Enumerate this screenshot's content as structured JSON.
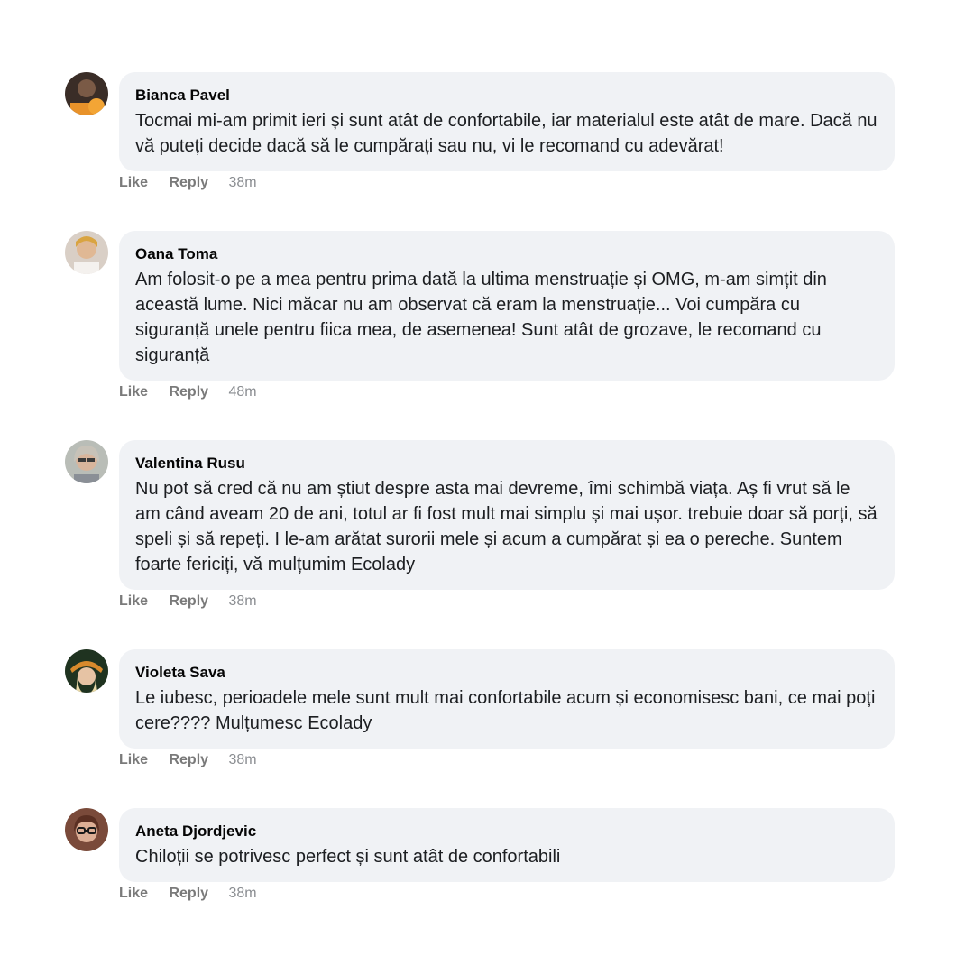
{
  "actions": {
    "like_label": "Like",
    "reply_label": "Reply"
  },
  "colors": {
    "bubble_background": "#f0f2f5",
    "action_text": "#7a7a7a",
    "author_text": "#050505"
  },
  "comments": [
    {
      "author": "Bianca Pavel",
      "text": "Tocmai mi-am primit ieri și sunt atât de confortabile, iar materialul este atât de mare. Dacă nu vă puteți decide dacă să le cumpărați sau nu, vi le recomand cu adevărat!",
      "time": "38m"
    },
    {
      "author": "Oana Toma",
      "text": "Am folosit-o pe a mea pentru prima dată la ultima menstruație și OMG, m-am simțit din această lume. Nici măcar nu am observat că eram la menstruație... Voi cumpăra cu siguranță unele pentru fiica mea, de asemenea! Sunt atât de grozave, le recomand cu siguranță",
      "time": "48m"
    },
    {
      "author": "Valentina Rusu",
      "text": "Nu pot să cred că nu am știut despre asta mai devreme, îmi schimbă viața. Aș fi vrut să le am când aveam 20 de ani, totul ar fi fost mult mai simplu și mai ușor. trebuie doar să porți, să speli și să repeți. I le-am arătat surorii mele și acum a cumpărat și ea o pereche. Suntem foarte fericiți, vă mulțumim Ecolady",
      "time": "38m"
    },
    {
      "author": "Violeta Sava",
      "text": "Le iubesc, perioadele mele sunt mult mai confortabile acum și economisesc bani, ce mai poți cere???? Mulțumesc Ecolady",
      "time": "38m"
    },
    {
      "author": "Aneta Djordjevic",
      "text": "Chiloții se potrivesc perfect și sunt atât de confortabili",
      "time": "38m"
    }
  ]
}
